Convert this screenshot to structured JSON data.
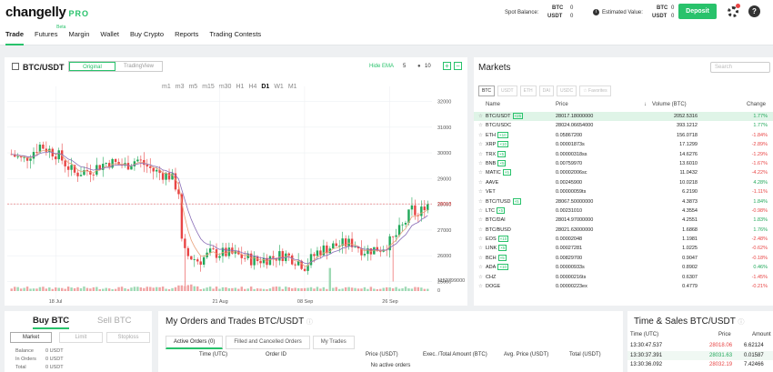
{
  "header": {
    "logo": "changelly",
    "logo_pro": "PRO",
    "nav": [
      {
        "label": "Trade",
        "active": true
      },
      {
        "label": "Futures",
        "badge": "Beta"
      },
      {
        "label": "Margin"
      },
      {
        "label": "Wallet"
      },
      {
        "label": "Buy Crypto"
      },
      {
        "label": "Reports"
      },
      {
        "label": "Trading Contests"
      }
    ],
    "spot_label": "Spot Balance:",
    "spot": [
      {
        "cur": "BTC",
        "val": "0"
      },
      {
        "cur": "USDT",
        "val": "0"
      }
    ],
    "est_label": "Estimated Value:",
    "est": [
      {
        "cur": "BTC",
        "val": "0"
      },
      {
        "cur": "USDT",
        "val": "0"
      }
    ],
    "deposit": "Deposit"
  },
  "chart": {
    "pair": "BTC/USDT",
    "view_original": "Original",
    "view_tv": "TradingView",
    "hide_ema": "Hide EMA",
    "ema1": "5",
    "ema2": "10",
    "timeframes": [
      "m1",
      "m3",
      "m5",
      "m15",
      "m30",
      "H1",
      "H4",
      "D1",
      "W1",
      "M1"
    ],
    "active_tf": "D1"
  },
  "chart_data": {
    "type": "candlestick",
    "x_labels": [
      "18 Jul",
      "21 Aug",
      "08 Sep",
      "26 Sep"
    ],
    "y_ticks": [
      "32000",
      "31000",
      "30000",
      "29000",
      "28000",
      "27000",
      "26000",
      "25000"
    ],
    "ylim": [
      24700,
      32300
    ],
    "current_price": "28018",
    "volume_label": "1152799000",
    "volume_zero": "0",
    "grid": true
  },
  "markets": {
    "title": "Markets",
    "search_placeholder": "Search",
    "tabs": [
      "BTC",
      "USDT",
      "ETH",
      "DAI",
      "USDC",
      "Favorites"
    ],
    "active_tab": "BTC",
    "col_name": "Name",
    "col_price": "Price",
    "col_volume": "Volume (BTC)",
    "col_change": "Change",
    "rows": [
      {
        "name": "BTC/USDT",
        "lev": "×25",
        "price": "28017.18000000",
        "volume": "2052.5316",
        "change": "1.77%",
        "dir": "pos",
        "sel": true
      },
      {
        "name": "BTC/USDC",
        "lev": "",
        "price": "28024.06654000",
        "volume": "393.1212",
        "change": "1.77%",
        "dir": "pos"
      },
      {
        "name": "ETH",
        "lev": "×10",
        "price": "0.05867200",
        "volume": "156.0718",
        "change": "-1.84%",
        "dir": "neg"
      },
      {
        "name": "XRP",
        "lev": "×10",
        "price": "0.00001873s",
        "volume": "17.1299",
        "change": "-2.89%",
        "dir": "neg"
      },
      {
        "name": "TRX",
        "lev": "×5",
        "price": "0.00000318ss",
        "volume": "14.6276",
        "change": "-1.29%",
        "dir": "neg"
      },
      {
        "name": "BNB",
        "lev": "×5",
        "price": "0.00759970",
        "volume": "13.6010",
        "change": "-1.67%",
        "dir": "neg"
      },
      {
        "name": "MATIC",
        "lev": "×5",
        "price": "0.00002006sc",
        "volume": "11.0432",
        "change": "-4.22%",
        "dir": "neg"
      },
      {
        "name": "AAVE",
        "lev": "",
        "price": "0.00245900",
        "volume": "10.0218",
        "change": "4.28%",
        "dir": "pos"
      },
      {
        "name": "VET",
        "lev": "",
        "price": "0.00000059ts",
        "volume": "6.2190",
        "change": "-1.11%",
        "dir": "neg"
      },
      {
        "name": "BTC/TUSD",
        "lev": "×5",
        "price": "28067.50000000",
        "volume": "4.3873",
        "change": "1.84%",
        "dir": "pos"
      },
      {
        "name": "LTC",
        "lev": "×5",
        "price": "0.00231010",
        "volume": "4.3554",
        "change": "-0.98%",
        "dir": "neg"
      },
      {
        "name": "BTC/DAI",
        "lev": "",
        "price": "28014.97000000",
        "volume": "4.2551",
        "change": "1.83%",
        "dir": "pos"
      },
      {
        "name": "BTC/BUSD",
        "lev": "",
        "price": "28021.63000000",
        "volume": "1.6868",
        "change": "1.76%",
        "dir": "pos"
      },
      {
        "name": "EOS",
        "lev": "×10",
        "price": "0.00002048",
        "volume": "1.1981",
        "change": "-2.48%",
        "dir": "neg"
      },
      {
        "name": "LINK",
        "lev": "×5",
        "price": "0.00027281",
        "volume": "1.0225",
        "change": "-0.62%",
        "dir": "neg"
      },
      {
        "name": "BCH",
        "lev": "×5",
        "price": "0.00829700",
        "volume": "0.9047",
        "change": "-0.18%",
        "dir": "neg"
      },
      {
        "name": "ADA",
        "lev": "×10",
        "price": "0.00000933s",
        "volume": "0.8902",
        "change": "0.46%",
        "dir": "pos"
      },
      {
        "name": "CHZ",
        "lev": "",
        "price": "0.00000216ts",
        "volume": "0.6307",
        "change": "-1.45%",
        "dir": "neg"
      },
      {
        "name": "DOGE",
        "lev": "",
        "price": "0.00000223ex",
        "volume": "0.4779",
        "change": "-0.21%",
        "dir": "neg"
      }
    ]
  },
  "buy": {
    "buy_tab": "Buy BTC",
    "sell_tab": "Sell BTC",
    "types": [
      "Market",
      "Limit",
      "Stoploss"
    ],
    "info": [
      {
        "label": "Balance",
        "value": "0 USDT"
      },
      {
        "label": "In Orders",
        "value": "0 USDT"
      },
      {
        "label": "Total",
        "value": "0 USDT"
      }
    ]
  },
  "orders": {
    "title": "My Orders and Trades BTC/USDT",
    "tabs": [
      "Active Orders (0)",
      "Filled and Cancelled Orders",
      "My Trades"
    ],
    "columns": [
      "Time (UTC)",
      "Order ID",
      "Price (USDT)",
      "Exec. /Total Amount (BTC)",
      "Avg. Price (USDT)",
      "Total (USDT)"
    ],
    "empty": "No active orders"
  },
  "ts": {
    "title": "Time & Sales BTC/USDT",
    "col_time": "Time (UTC)",
    "col_price": "Price",
    "col_amount": "Amount",
    "rows": [
      {
        "time": "13:30:47.537",
        "price": "28018.06",
        "amount": "6.62124",
        "dir": "neg"
      },
      {
        "time": "13:30:37.391",
        "price": "28031.63",
        "amount": "0.01587",
        "dir": "pos"
      },
      {
        "time": "13:30:36.092",
        "price": "28032.19",
        "amount": "7.42466",
        "dir": "neg"
      }
    ]
  },
  "colors": {
    "accent": "#28c26b",
    "up": "#21a85a",
    "down": "#e84545",
    "ema_fast": "#e8a07a",
    "ema_slow": "#8a6fb8"
  }
}
